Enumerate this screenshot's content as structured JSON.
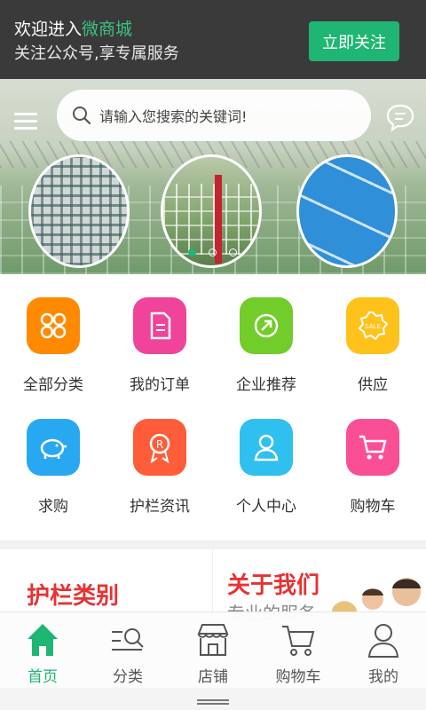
{
  "topbar": {
    "welcome_prefix": "欢迎进入",
    "welcome_brand": "微商城",
    "subtitle": "关注公众号,享专属服务",
    "follow_button": "立即关注"
  },
  "banner": {
    "search_placeholder": "请输入您搜索的关键词!",
    "active_slide": 1,
    "slide_count": 3
  },
  "categories": [
    {
      "label": "全部分类",
      "icon": "grid-icon",
      "color": "#ff8a00"
    },
    {
      "label": "我的订单",
      "icon": "document-icon",
      "color": "#f0439a"
    },
    {
      "label": "企业推荐",
      "icon": "share-icon",
      "color": "#72cd2a"
    },
    {
      "label": "供应",
      "icon": "sale-badge-icon",
      "color": "#ffc21a"
    },
    {
      "label": "求购",
      "icon": "piggy-bank-icon",
      "color": "#29a8f2"
    },
    {
      "label": "护栏资讯",
      "icon": "award-icon",
      "color": "#ff5c3a"
    },
    {
      "label": "个人中心",
      "icon": "user-icon",
      "color": "#2fc0f0"
    },
    {
      "label": "购物车",
      "icon": "cart-icon",
      "color": "#fb4f95"
    }
  ],
  "promo": {
    "left_title": "护栏类别",
    "right_title": "关于我们",
    "right_subtitle": "专业的服务"
  },
  "tabbar": [
    {
      "label": "首页",
      "icon": "home-icon",
      "active": true
    },
    {
      "label": "分类",
      "icon": "search-list-icon",
      "active": false
    },
    {
      "label": "店铺",
      "icon": "store-icon",
      "active": false
    },
    {
      "label": "购物车",
      "icon": "cart-icon",
      "active": false
    },
    {
      "label": "我的",
      "icon": "user-icon",
      "active": false
    }
  ],
  "colors": {
    "accent": "#1fb573",
    "promo_title": "#e53333",
    "topbar_bg": "#3a3a3a"
  }
}
